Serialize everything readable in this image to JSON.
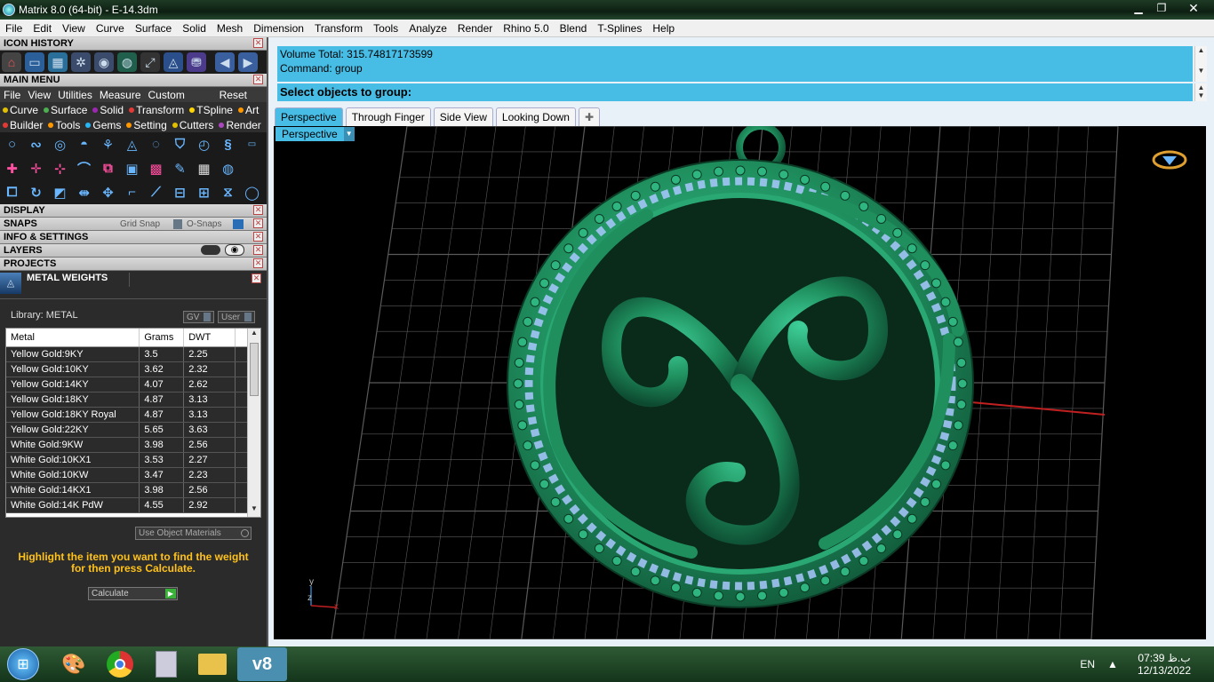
{
  "window": {
    "title": "Matrix 8.0 (64-bit) - E-14.3dm",
    "min_icon": "minimize-icon",
    "max_icon": "maximize-icon",
    "close_glyph": "✕"
  },
  "menubar": [
    "File",
    "Edit",
    "View",
    "Curve",
    "Surface",
    "Solid",
    "Mesh",
    "Dimension",
    "Transform",
    "Tools",
    "Analyze",
    "Render",
    "Rhino 5.0",
    "Blend",
    "T-Splines",
    "Help"
  ],
  "panels": {
    "icon_history": "ICON HISTORY",
    "main_menu": "MAIN MENU",
    "main_menu_items": [
      "File",
      "View",
      "Utilities",
      "Measure",
      "Custom"
    ],
    "reset": "Reset",
    "categories_row1": [
      {
        "label": "Curve",
        "color": "#e0c000"
      },
      {
        "label": "Surface",
        "color": "#4caf50"
      },
      {
        "label": "Solid",
        "color": "#9c27b0"
      },
      {
        "label": "Transform",
        "color": "#e53935"
      },
      {
        "label": "TSpline",
        "color": "#ffd600"
      },
      {
        "label": "Art",
        "color": "#ff9800"
      }
    ],
    "categories_row2": [
      {
        "label": "Builder",
        "color": "#e53935"
      },
      {
        "label": "Tools",
        "color": "#ff9800"
      },
      {
        "label": "Gems",
        "color": "#29b6f6"
      },
      {
        "label": "Setting",
        "color": "#ff9800"
      },
      {
        "label": "Cutters",
        "color": "#e0c000"
      },
      {
        "label": "Render",
        "color": "#ab47bc"
      }
    ],
    "display": "DISPLAY",
    "snaps": "SNAPS",
    "grid_snap": "Grid Snap",
    "o_snaps": "O-Snaps",
    "info_settings": "INFO & SETTINGS",
    "layers": "LAYERS",
    "projects": "PROJECTS",
    "metal_weights": "METAL WEIGHTS"
  },
  "metal_weights": {
    "library": "Library: METAL",
    "gv": "GV",
    "user": "User",
    "columns": [
      "Metal",
      "Grams",
      "DWT"
    ],
    "rows": [
      [
        "Yellow Gold:9KY",
        "3.5",
        "2.25"
      ],
      [
        "Yellow Gold:10KY",
        "3.62",
        "2.32"
      ],
      [
        "Yellow Gold:14KY",
        "4.07",
        "2.62"
      ],
      [
        "Yellow Gold:18KY",
        "4.87",
        "3.13"
      ],
      [
        "Yellow Gold:18KY Royal",
        "4.87",
        "3.13"
      ],
      [
        "Yellow Gold:22KY",
        "5.65",
        "3.63"
      ],
      [
        "White Gold:9KW",
        "3.98",
        "2.56"
      ],
      [
        "White Gold:10KX1",
        "3.53",
        "2.27"
      ],
      [
        "White Gold:10KW",
        "3.47",
        "2.23"
      ],
      [
        "White Gold:14KX1",
        "3.98",
        "2.56"
      ],
      [
        "White Gold:14K PdW",
        "4.55",
        "2.92"
      ]
    ],
    "use_object_materials": "Use Object Materials",
    "hint": "Highlight the item you want to find the weight for then press Calculate.",
    "calculate": "Calculate"
  },
  "command": {
    "history": [
      "Volume Total: 315.74817173599",
      "Command: group"
    ],
    "prompt": "Select objects to group:"
  },
  "viewport_tabs": [
    "Perspective",
    "Through Finger",
    "Side View",
    "Looking Down"
  ],
  "viewport": {
    "label": "Perspective",
    "axis_y": "y",
    "axis_z": "z",
    "axis_x": "x",
    "colors": {
      "body": "#1f8f5e",
      "gem": "#a9c8ff",
      "grid": "#5a5a5a",
      "x_axis": "#c02020",
      "y_axis": "#2a7fc0"
    }
  },
  "taskbar": {
    "lang": "EN",
    "time": "07:39 ب.ظ",
    "date": "12/13/2022",
    "matrix_label": "v8"
  }
}
